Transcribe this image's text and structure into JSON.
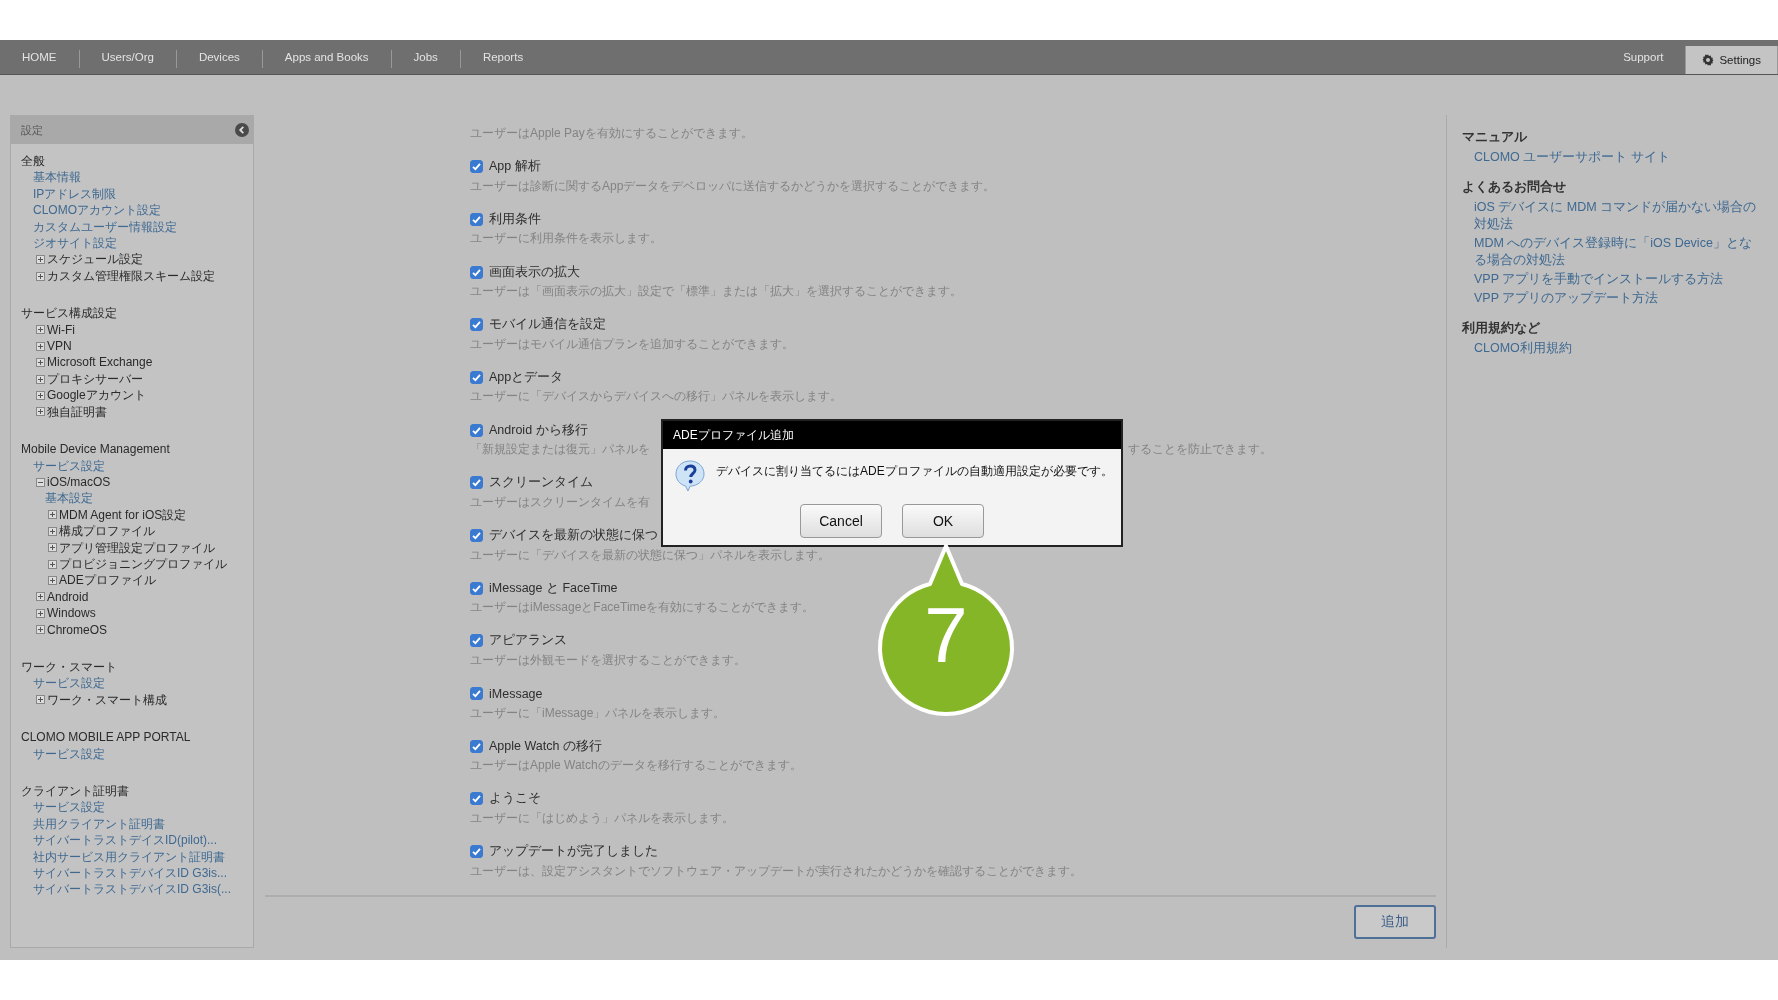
{
  "nav": {
    "left_tabs": [
      {
        "label": "HOME",
        "selected": false
      },
      {
        "label": "Users/Org",
        "selected": false
      },
      {
        "label": "Devices",
        "selected": false
      },
      {
        "label": "Apps and Books",
        "selected": false
      },
      {
        "label": "Jobs",
        "selected": false
      },
      {
        "label": "Reports",
        "selected": false
      }
    ],
    "right_tabs": [
      {
        "label": "Support",
        "selected": false
      },
      {
        "label": "Settings",
        "selected": true
      }
    ]
  },
  "sidebar": {
    "title": "設定",
    "groups": [
      {
        "title": "全般",
        "children": [
          {
            "kind": "link",
            "label": "基本情報"
          },
          {
            "kind": "link",
            "label": "IPアドレス制限"
          },
          {
            "kind": "link",
            "label": "CLOMOアカウント設定"
          },
          {
            "kind": "link",
            "label": "カスタムユーザー情報設定"
          },
          {
            "kind": "link",
            "label": "ジオサイト設定"
          },
          {
            "kind": "node",
            "label": "スケジュール設定",
            "expanded": false
          },
          {
            "kind": "node",
            "label": "カスタム管理権限スキーム設定",
            "expanded": false
          }
        ]
      },
      {
        "title": "サービス構成設定",
        "children": [
          {
            "kind": "node",
            "label": "Wi-Fi",
            "expanded": false
          },
          {
            "kind": "node",
            "label": "VPN",
            "expanded": false
          },
          {
            "kind": "node",
            "label": "Microsoft Exchange",
            "expanded": false
          },
          {
            "kind": "node",
            "label": "プロキシサーバー",
            "expanded": false
          },
          {
            "kind": "node",
            "label": "Googleアカウント",
            "expanded": false
          },
          {
            "kind": "node",
            "label": "独自証明書",
            "expanded": false
          }
        ]
      },
      {
        "title": "Mobile Device Management",
        "children": [
          {
            "kind": "link",
            "label": "サービス設定"
          },
          {
            "kind": "node",
            "label": "iOS/macOS",
            "expanded": true,
            "children": [
              {
                "kind": "link",
                "label": "基本設定"
              },
              {
                "kind": "node",
                "label": "MDM Agent for iOS設定",
                "expanded": false
              },
              {
                "kind": "node",
                "label": "構成プロファイル",
                "expanded": false
              },
              {
                "kind": "node",
                "label": "アプリ管理設定プロファイル",
                "expanded": false
              },
              {
                "kind": "node",
                "label": "プロビジョニングプロファイル",
                "expanded": false
              },
              {
                "kind": "node",
                "label": "ADEプロファイル",
                "expanded": false
              }
            ]
          },
          {
            "kind": "node",
            "label": "Android",
            "expanded": false
          },
          {
            "kind": "node",
            "label": "Windows",
            "expanded": false
          },
          {
            "kind": "node",
            "label": "ChromeOS",
            "expanded": false
          }
        ]
      },
      {
        "title": "ワーク・スマート",
        "children": [
          {
            "kind": "link",
            "label": "サービス設定"
          },
          {
            "kind": "node",
            "label": "ワーク・スマート構成",
            "expanded": false
          }
        ]
      },
      {
        "title": "CLOMO MOBILE APP PORTAL",
        "children": [
          {
            "kind": "link",
            "label": "サービス設定"
          }
        ]
      },
      {
        "title": "クライアント証明書",
        "children": [
          {
            "kind": "link",
            "label": "サービス設定"
          },
          {
            "kind": "link",
            "label": "共用クライアント証明書"
          },
          {
            "kind": "link",
            "label": "サイバートラストデイスID(pilot)..."
          },
          {
            "kind": "link",
            "label": "社内サービス用クライアント証明書"
          },
          {
            "kind": "link",
            "label": "サイバートラストデバイスID G3is..."
          },
          {
            "kind": "link",
            "label": "サイバートラストデバイスID G3is(..."
          }
        ]
      }
    ]
  },
  "settings": [
    {
      "description": [
        "ユーザーはApple Payを有効にすることができます。"
      ]
    },
    {
      "label": "App 解析",
      "checked": true,
      "description": [
        "ユーザーは診断に関するAppデータをデベロッパに送信するかどうかを選択することができます。"
      ]
    },
    {
      "label": "利用条件",
      "checked": true,
      "description": [
        "ユーザーに利用条件を表示します。"
      ]
    },
    {
      "label": "画面表示の拡大",
      "checked": true,
      "description": [
        "ユーザーは「画面表示の拡大」設定で「標準」または「拡大」を選択することができます。"
      ]
    },
    {
      "label": "モバイル通信を設定",
      "checked": true,
      "description": [
        "ユーザーはモバイル通信プランを追加することができます。"
      ]
    },
    {
      "label": "Appとデータ",
      "checked": true,
      "description": [
        "ユーザーに「デバイスからデバイスへの移行」パネルを表示します。"
      ]
    },
    {
      "label": "Android から移行",
      "checked": true,
      "description": [
        "「新規設定または復元」パネルを",
        "することを防止できます。"
      ]
    },
    {
      "label": "スクリーンタイム",
      "checked": true,
      "description": [
        "ユーザーはスクリーンタイムを有"
      ]
    },
    {
      "label": "デバイスを最新の状態に保つ",
      "checked": true,
      "description": [
        "ユーザーに「デバイスを最新の状態に保つ」パネルを表示します。"
      ]
    },
    {
      "label": "iMessage と FaceTime",
      "checked": true,
      "description": [
        "ユーザーはiMessageとFaceTimeを有効にすることができます。"
      ]
    },
    {
      "label": "アピアランス",
      "checked": true,
      "description": [
        "ユーザーは外観モードを選択することができます。"
      ]
    },
    {
      "label": "iMessage",
      "checked": true,
      "description": [
        "ユーザーに「iMessage」パネルを表示します。"
      ]
    },
    {
      "label": "Apple Watch の移行",
      "checked": true,
      "description": [
        "ユーザーはApple Watchのデータを移行することができます。"
      ]
    },
    {
      "label": "ようこそ",
      "checked": true,
      "description": [
        "ユーザーに「はじめよう」パネルを表示します。"
      ]
    },
    {
      "label": "アップデートが完了しました",
      "checked": true,
      "description": [
        "ユーザーは、設定アシスタントでソフトウェア・アップデートが実行されたかどうかを確認することができます。"
      ]
    }
  ],
  "add_button": "追加",
  "help": [
    {
      "heading": "マニュアル",
      "links": [
        "CLOMO ユーザーサポート サイト"
      ]
    },
    {
      "heading": "よくあるお問合せ",
      "links": [
        "iOS デバイスに MDM コマンドが届かない場合の対処法",
        "MDM へのデバイス登録時に「iOS Device」となる場合の対処法",
        "VPP アプリを手動でインストールする方法",
        "VPP アプリのアップデート方法"
      ]
    },
    {
      "heading": "利用規約など",
      "links": [
        "CLOMO利用規約"
      ]
    }
  ],
  "dialog": {
    "title": "ADEプロファイル追加",
    "message": "デバイスに割り当てるにはADEプロファイルの自動適用設定が必要です。",
    "buttons": [
      "Cancel",
      "OK"
    ]
  },
  "callout": {
    "text": "7"
  }
}
